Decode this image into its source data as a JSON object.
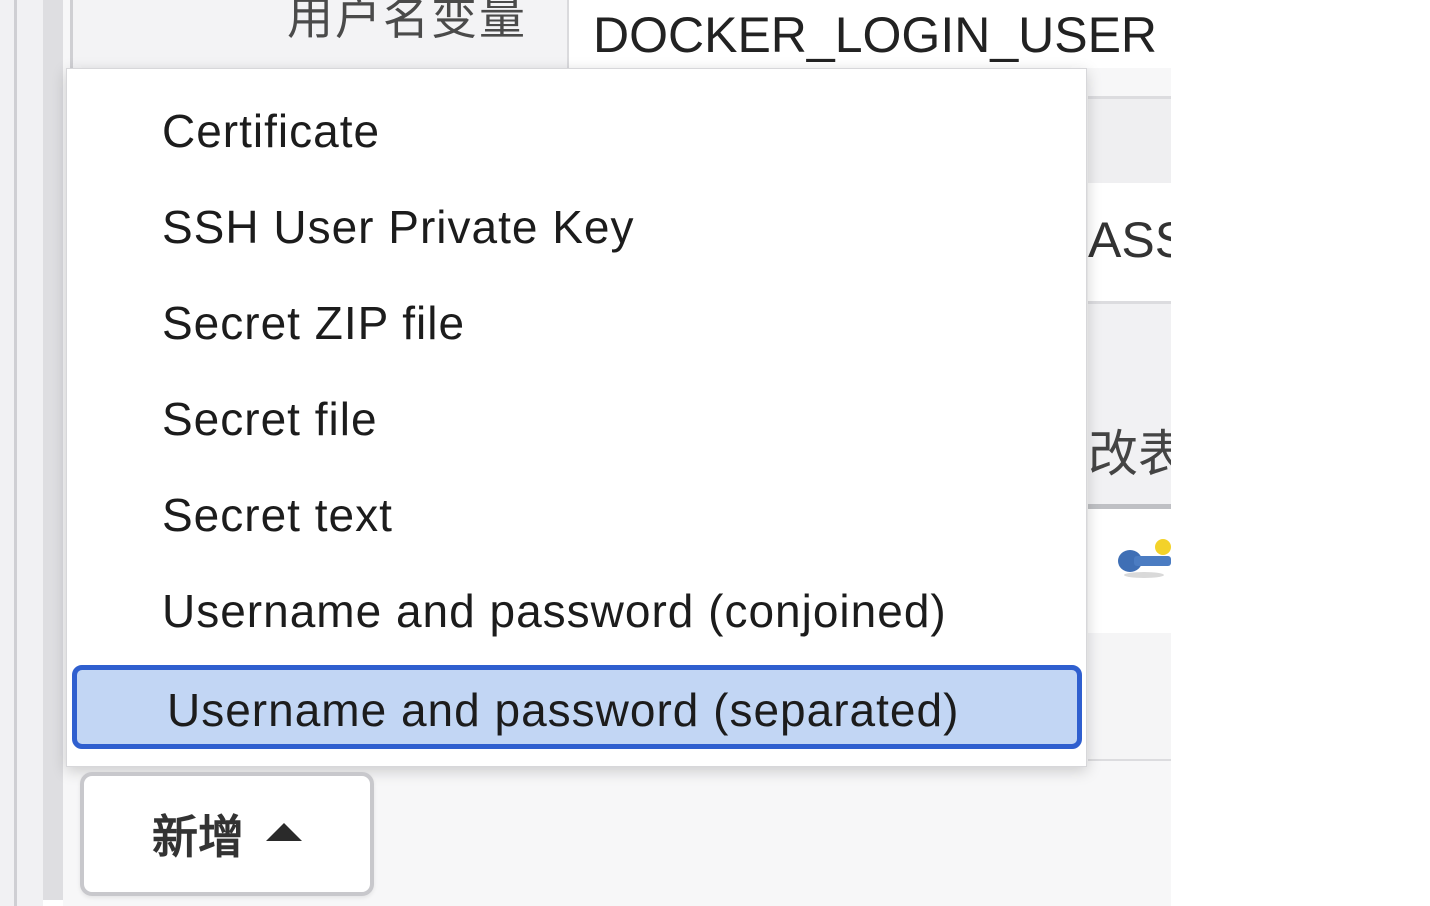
{
  "form": {
    "username_variable_label": "用户名变量",
    "username_variable_value": "DOCKER_LOGIN_USER",
    "password_variable_partial": "ASS",
    "description_partial": "改表"
  },
  "dropdown": {
    "items": [
      {
        "label": "Certificate",
        "selected": false
      },
      {
        "label": "SSH User Private Key",
        "selected": false
      },
      {
        "label": "Secret ZIP file",
        "selected": false
      },
      {
        "label": "Secret file",
        "selected": false
      },
      {
        "label": "Secret text",
        "selected": false
      },
      {
        "label": "Username and password (conjoined)",
        "selected": false
      },
      {
        "label": "Username and password (separated)",
        "selected": true
      }
    ]
  },
  "add_button": {
    "label": "新增"
  },
  "colors": {
    "selection_fill": "#c2d6f4",
    "selection_border": "#2f5fcf"
  },
  "icons": {
    "key": "key-icon",
    "caret": "caret-up-icon"
  }
}
